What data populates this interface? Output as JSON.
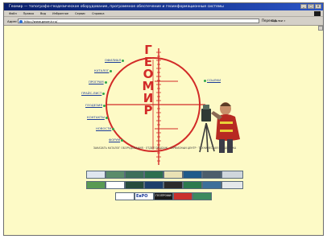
{
  "window": {
    "title": "Геомир — топографо-геодезическое оборудование, программное обеспечение и геоинформационные системы",
    "controls": [
      "_",
      "□",
      "×"
    ]
  },
  "menu": {
    "items": [
      "Файл",
      "Правка",
      "Вид",
      "Избранное",
      "Сервис",
      "Справка"
    ]
  },
  "address": {
    "label": "Адрес",
    "url": "http://www.geomir.ru/",
    "go": "Переход",
    "links": "Ссылки »"
  },
  "logo": {
    "letters": [
      "Г",
      "Е",
      "О",
      "М",
      "И",
      "Р"
    ]
  },
  "nav": {
    "left": [
      "ОФИЛИАЛ",
      "КАТАЛОГ",
      "ПРОГРАМ",
      "ПРАЙС-ЛИСТ",
      "ГЕОДЕЗИЯ",
      "КОНТАКТЫ",
      "НОВОСТИ",
      "ФОРУМ"
    ],
    "right": "ССЫЛКИ"
  },
  "strip_text": "ЗАКАЗАТЬ КАТАЛОГ ОБОРУДОВАНИЯ · ОТДЕЛ ПРОДАЖ · СЕРВИСНЫЙ ЦЕНТР · ТЕХНИЧЕСКАЯ ПОДДЕРЖКА",
  "banners": {
    "row1": [
      "",
      "",
      "",
      "",
      "",
      "",
      "",
      ""
    ],
    "row2": [
      "",
      "",
      "",
      "",
      "",
      "",
      "",
      ""
    ],
    "row3": [
      "",
      "ЕвРО",
      "ГЕОПРОФИ",
      "",
      "",
      "",
      "",
      ""
    ]
  }
}
